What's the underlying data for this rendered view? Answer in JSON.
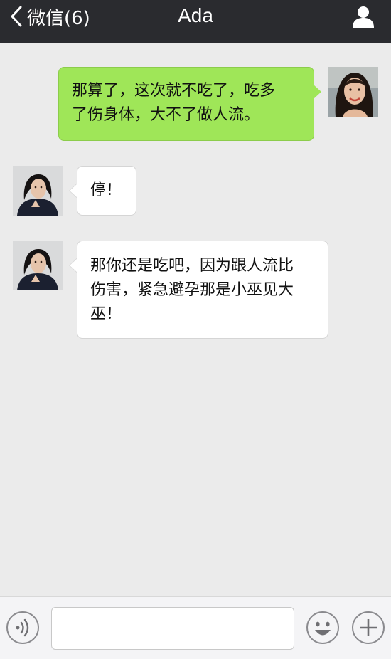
{
  "nav": {
    "back_label": "微信(6)",
    "title": "Ada",
    "contact_icon": "person-icon"
  },
  "messages": [
    {
      "direction": "outgoing",
      "text_lines": [
        "那算了，这次就不吃了，吃多",
        "了伤身体，大不了做人流。"
      ]
    },
    {
      "direction": "incoming",
      "text_lines": [
        "停！"
      ]
    },
    {
      "direction": "incoming",
      "text_lines": [
        "那你还是吃吧，因为跟人流比",
        "伤害，紧急避孕那是小巫见大",
        "巫！"
      ]
    }
  ],
  "composer": {
    "voice_icon": "voice-icon",
    "input_value": "",
    "emoji_icon": "emoji-icon",
    "plus_icon": "plus-icon"
  },
  "colors": {
    "nav_bg": "#2a2b2f",
    "chat_bg": "#ebebeb",
    "outgoing_bubble": "#9fe658",
    "incoming_bubble": "#ffffff"
  }
}
